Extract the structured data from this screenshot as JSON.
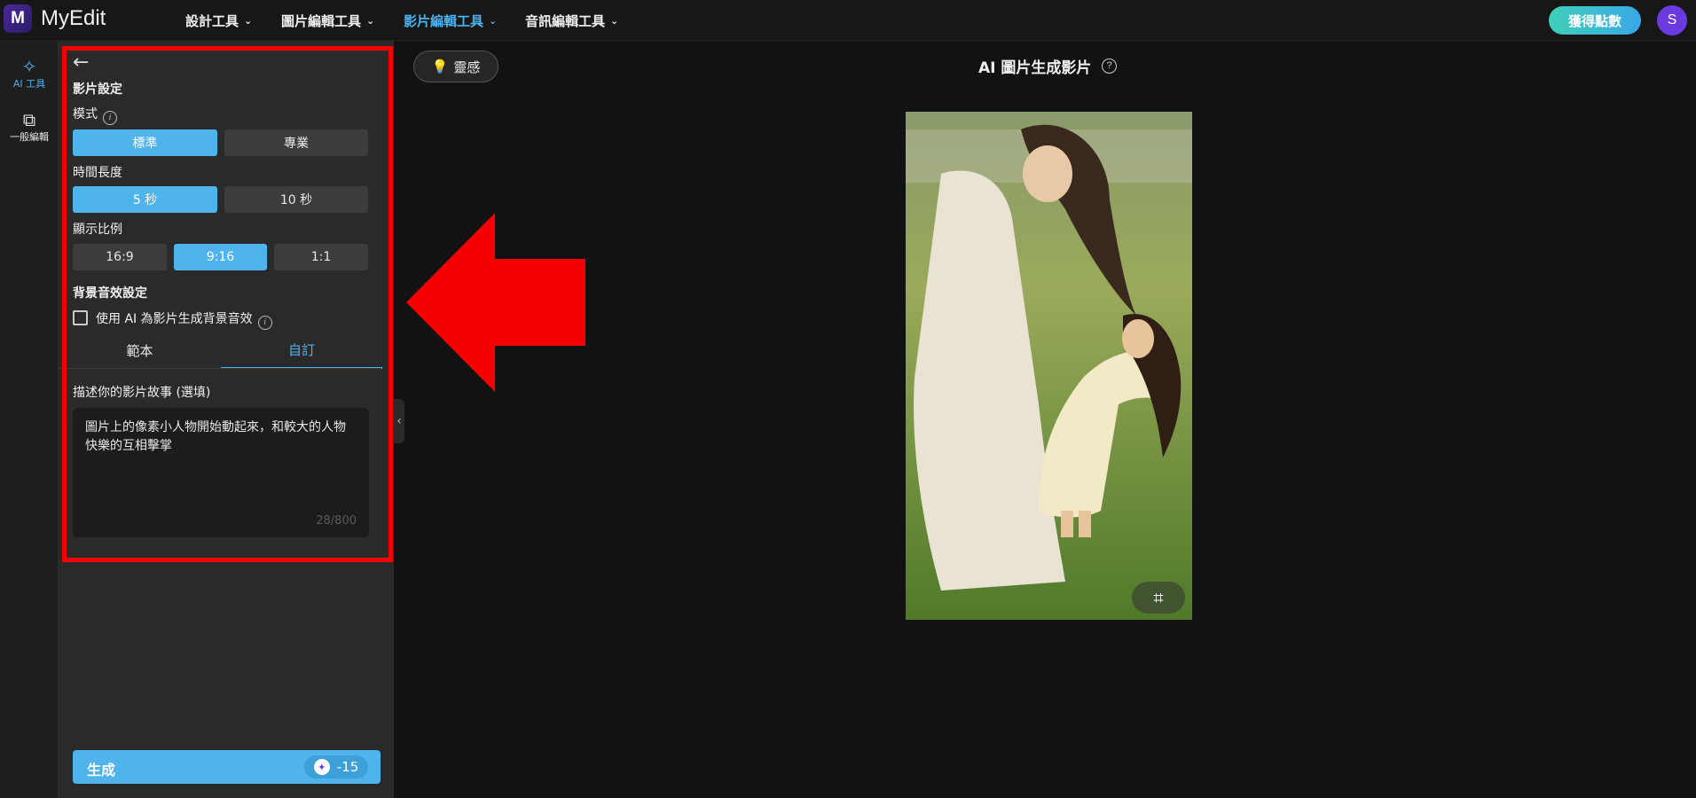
{
  "app": {
    "logo_letter": "M",
    "name": "MyEdit"
  },
  "nav": {
    "design": "設計工具",
    "photo": "圖片編輯工具",
    "video": "影片編輯工具",
    "audio": "音訊編輯工具",
    "active": "video"
  },
  "header": {
    "points_button": "獲得點數",
    "avatar_letter": "S"
  },
  "rail": {
    "ai_tools": "AI 工具",
    "general_edit": "一般編輯"
  },
  "panel": {
    "section_title": "影片設定",
    "mode_label": "模式",
    "mode_options": [
      "標準",
      "專業"
    ],
    "mode_selected": "標準",
    "duration_label": "時間長度",
    "duration_options": [
      "5 秒",
      "10 秒"
    ],
    "duration_selected": "5 秒",
    "ratio_label": "顯示比例",
    "ratio_options": [
      "16:9",
      "9:16",
      "1:1"
    ],
    "ratio_selected": "9:16",
    "sound_title": "背景音效設定",
    "sound_checkbox_label": "使用 AI 為影片生成背景音效",
    "sound_checked": false,
    "tabs": [
      "範本",
      "自訂"
    ],
    "tab_selected": "自訂",
    "story_label": "描述你的影片故事 (選填)",
    "story_text": "圖片上的像素小人物開始動起來，和較大的人物快樂的互相擊掌",
    "char_count": "28/800",
    "generate_label": "生成",
    "cost": "-15"
  },
  "main": {
    "inspiration_button": "靈感",
    "title": "AI 圖片生成影片"
  },
  "colors": {
    "accent": "#4fb3ec",
    "highlight": "#f40000",
    "avatar": "#6a3ae0"
  }
}
